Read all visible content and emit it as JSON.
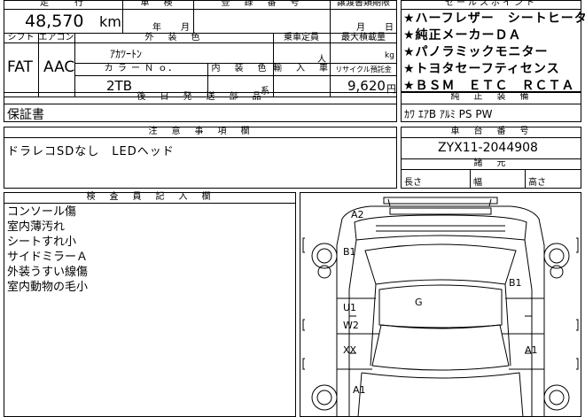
{
  "header": {
    "mileage": "走　　行",
    "body": "車　検",
    "reg_date": "登　録　番　号",
    "transfer": "譲渡書類期限",
    "sales_points": "セールスポイント"
  },
  "mileage": {
    "value": "48,570",
    "unit": "km"
  },
  "inspection": {
    "year_label": "年",
    "month_label": "月"
  },
  "transfer_deadline": {
    "month_label": "月",
    "day_label": "日"
  },
  "labels": {
    "shift": "シフト",
    "aircon": "エアコン",
    "exterior_color": "外　装　色",
    "capacity": "乗車定員",
    "max_load": "最大積載量",
    "color_no": "カ ラ ー Ｎ ｏ．",
    "interior_color": "内　装　色",
    "import": "輸　入　車",
    "recycle": "リサイクル預託金",
    "later_parts": "後　日　発　送　部　品",
    "genuine_equipment": "純　正　装　備",
    "caution": "注　意　事　項　欄",
    "chassis": "車　台　番　号",
    "dimensions": "諸　元",
    "length": "長さ",
    "width": "幅",
    "height": "高さ",
    "inspector": "検　査　員　記　入　欄"
  },
  "vehicle": {
    "shift": "FAT",
    "aircon": "AAC",
    "exterior_color": "ｱｶﾂｰﾄﾝ",
    "capacity_unit": "人",
    "max_load_unit": "kg",
    "color_no": "2TB",
    "interior_unit": "系",
    "recycle_fee": "9,620",
    "recycle_unit": "円",
    "chassis_no": "ZYX11-2044908"
  },
  "sales_points": [
    "★ハーフレザー　シートヒーター",
    "★純正メーカーＤＡ",
    "★パノラミックモニター",
    "★トヨタセーフティセンス",
    "★ＢＳＭ　ＥＴＣ　ＲＣＴＡ"
  ],
  "later_parts_value": "保証書",
  "genuine_equipment_value": "ｶﾜ ｴｱB ｱﾙﾐ PS PW",
  "caution_value": "ドラレコSDなし　LEDヘッド",
  "inspector_notes": [
    "コンソール傷",
    "室内薄汚れ",
    "シートすれ小",
    "サイドミラーＡ",
    "外装うすい線傷",
    "室内動物の毛小"
  ],
  "damage_marks": {
    "a2": "A2",
    "b1_left": "B1",
    "b1_right": "B1",
    "g": "G",
    "u1": "U1",
    "w2": "W2",
    "xx": "XX",
    "a1_right": "A1",
    "a1_left": "A1"
  }
}
